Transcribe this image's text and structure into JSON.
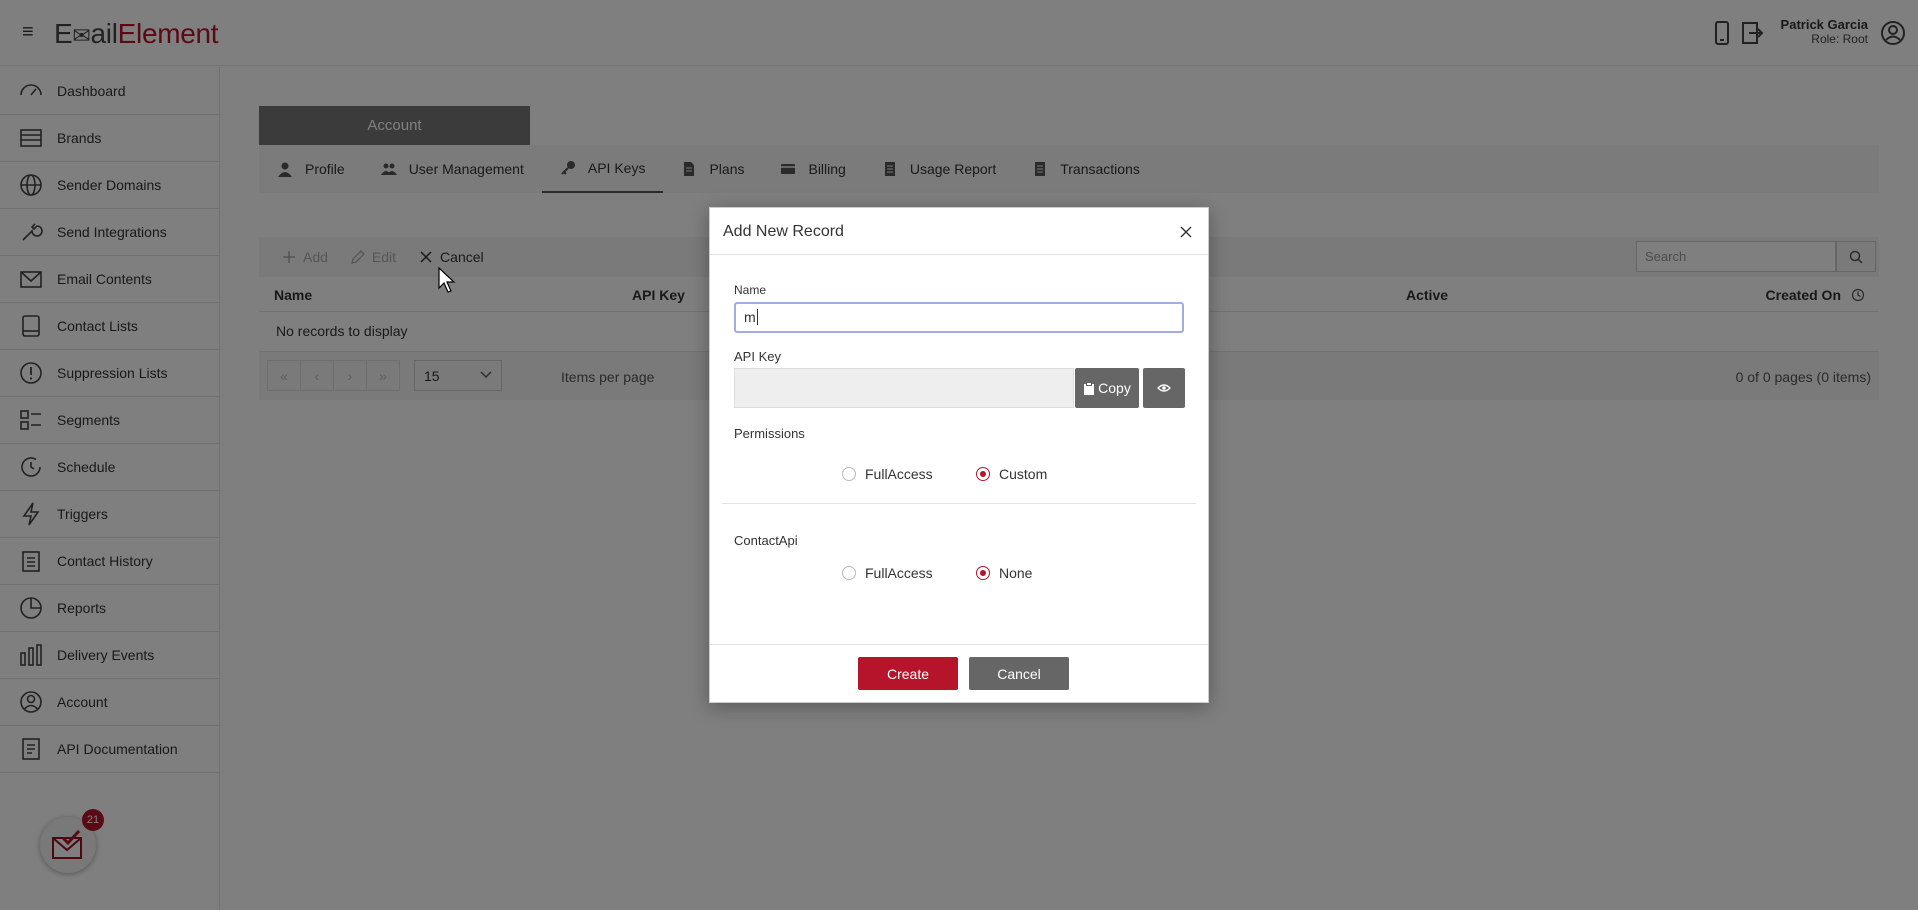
{
  "header": {
    "logo_part1": "E",
    "logo_part2": "ail",
    "logo_part3": "Element",
    "user_name": "Patrick Garcia",
    "user_role": "Role: Root"
  },
  "sidebar": {
    "items": [
      {
        "label": "Dashboard",
        "icon": "dashboard-icon"
      },
      {
        "label": "Brands",
        "icon": "brands-icon"
      },
      {
        "label": "Sender Domains",
        "icon": "globe-icon"
      },
      {
        "label": "Send Integrations",
        "icon": "wrench-icon"
      },
      {
        "label": "Email Contents",
        "icon": "envelope-icon"
      },
      {
        "label": "Contact Lists",
        "icon": "contacts-book-icon"
      },
      {
        "label": "Suppression Lists",
        "icon": "exclamation-icon"
      },
      {
        "label": "Segments",
        "icon": "segments-icon"
      },
      {
        "label": "Schedule",
        "icon": "clock-refresh-icon"
      },
      {
        "label": "Triggers",
        "icon": "lightning-icon"
      },
      {
        "label": "Contact History",
        "icon": "clipboard-icon"
      },
      {
        "label": "Reports",
        "icon": "pie-chart-icon"
      },
      {
        "label": "Delivery Events",
        "icon": "bar-chart-icon"
      },
      {
        "label": "Account",
        "icon": "user-circle-icon"
      },
      {
        "label": "API Documentation",
        "icon": "document-icon"
      }
    ],
    "badge_count": "21"
  },
  "main": {
    "account_tab": "Account",
    "subtabs": [
      {
        "label": "Profile",
        "icon": "user-icon"
      },
      {
        "label": "User Management",
        "icon": "users-icon"
      },
      {
        "label": "API Keys",
        "icon": "key-icon",
        "active": true
      },
      {
        "label": "Plans",
        "icon": "file-icon"
      },
      {
        "label": "Billing",
        "icon": "credit-card-icon"
      },
      {
        "label": "Usage Report",
        "icon": "report-icon"
      },
      {
        "label": "Transactions",
        "icon": "receipt-icon"
      }
    ],
    "toolbar": {
      "add": "Add",
      "edit": "Edit",
      "cancel": "Cancel",
      "search_placeholder": "Search"
    },
    "grid": {
      "columns": [
        "Name",
        "API Key",
        "Active",
        "Created On"
      ],
      "empty_text": "No records to display",
      "page_size": "15",
      "items_per_page": "Items per page",
      "page_info": "0 of 0 pages (0 items)"
    }
  },
  "dialog": {
    "title": "Add New Record",
    "name_label": "Name",
    "name_value": "m",
    "api_key_label": "API Key",
    "copy_label": "Copy",
    "permissions_label": "Permissions",
    "perm_opt1": "FullAccess",
    "perm_opt2": "Custom",
    "perm_selected": "Custom",
    "contactapi_label": "ContactApi",
    "ca_opt1": "FullAccess",
    "ca_opt2": "None",
    "ca_selected": "None",
    "create_label": "Create",
    "cancel_label": "Cancel"
  },
  "colors": {
    "brand": "#b5142b",
    "gray_button": "#666666"
  }
}
